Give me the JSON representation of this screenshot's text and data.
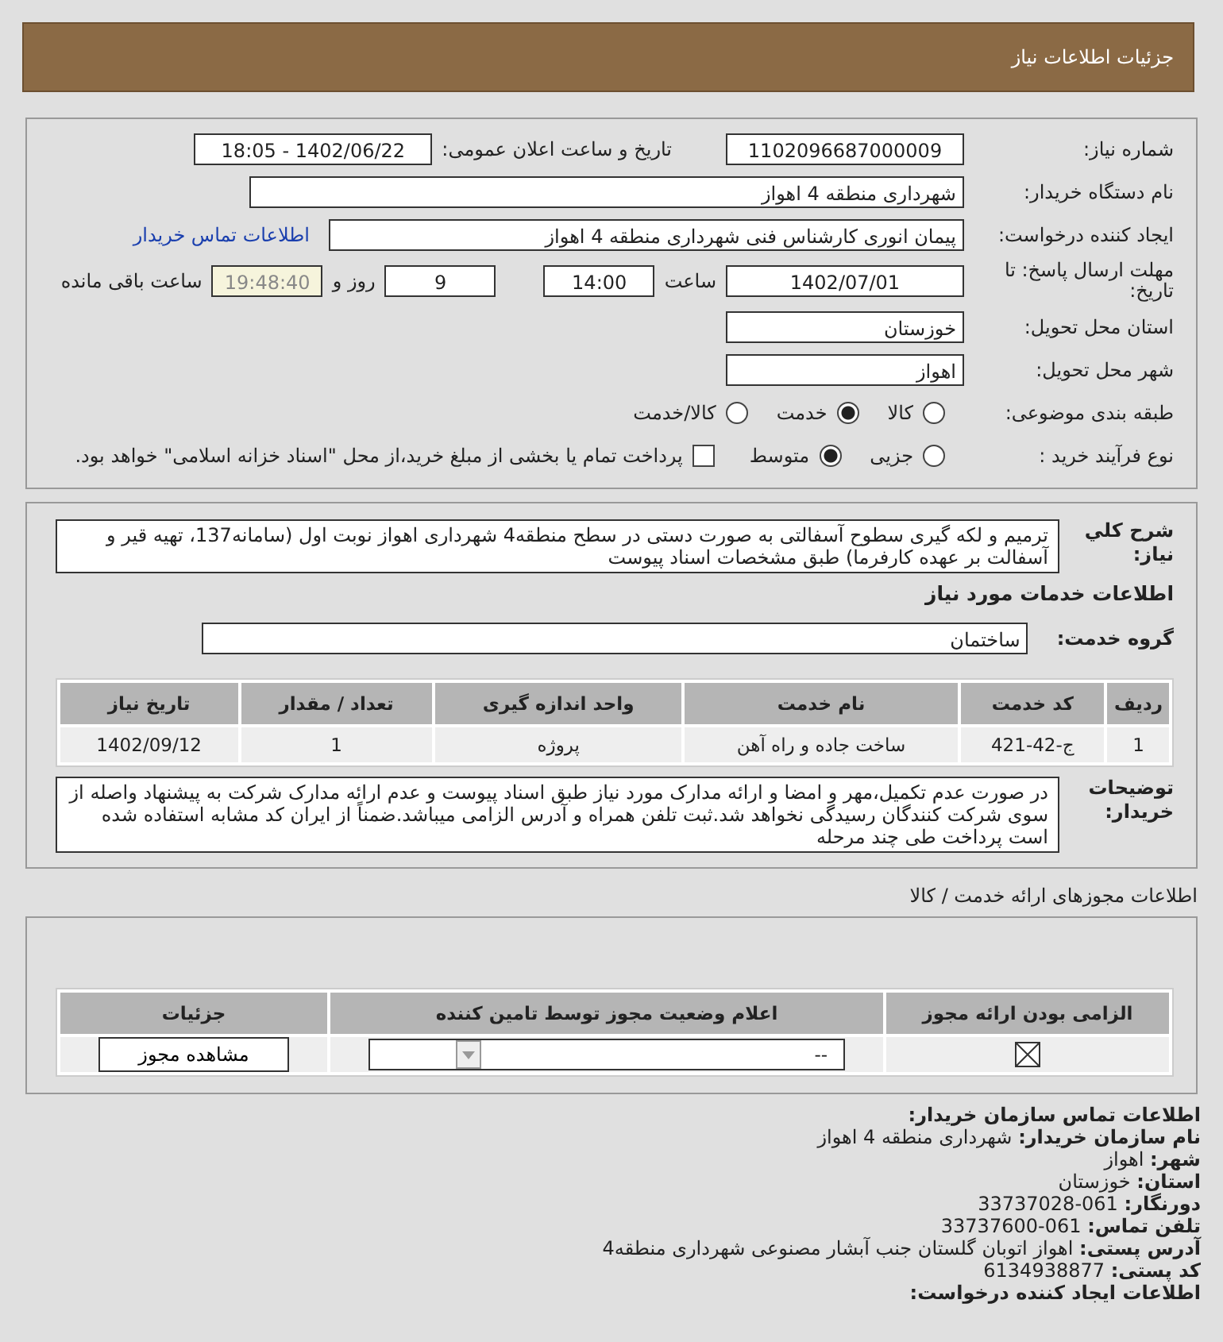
{
  "header": {
    "title": "جزئیات اطلاعات نیاز"
  },
  "need_info": {
    "need_number": {
      "label": "شماره نیاز:",
      "value": "1102096687000009"
    },
    "announce": {
      "label": "تاریخ و ساعت اعلان عمومی:",
      "value": "1402/06/22 - 18:05"
    },
    "buyer_org": {
      "label": "نام دستگاه خریدار:",
      "value": "شهرداری منطقه 4 اهواز"
    },
    "creator": {
      "label": "ایجاد کننده درخواست:",
      "value": "پیمان انوری کارشناس فنی  شهرداری منطقه 4 اهواز",
      "link": "اطلاعات تماس خریدار"
    },
    "deadline": {
      "label": "مهلت ارسال پاسخ: تا تاریخ:",
      "date": "1402/07/01",
      "time_label": "ساعت",
      "time": "14:00",
      "days": "9",
      "days_label": "روز و",
      "remaining": "19:48:40",
      "remaining_label": "ساعت باقی مانده"
    },
    "province": {
      "label": "استان محل تحویل:",
      "value": "خوزستان"
    },
    "city": {
      "label": "شهر محل تحویل:",
      "value": "اهواز"
    },
    "category": {
      "label": "طبقه بندی موضوعی:",
      "options": [
        {
          "label": "کالا",
          "selected": false
        },
        {
          "label": "خدمت",
          "selected": true
        },
        {
          "label": "کالا/خدمت",
          "selected": false
        }
      ]
    },
    "process": {
      "label": "نوع فرآیند خرید :",
      "options": [
        {
          "label": "جزیی",
          "selected": false
        },
        {
          "label": "متوسط",
          "selected": true
        }
      ],
      "treasury": {
        "checked": false,
        "label": "پرداخت تمام یا بخشی از مبلغ خرید،از محل \"اسناد خزانه اسلامی\" خواهد بود."
      }
    }
  },
  "services": {
    "summary": {
      "label": "شرح کلي نیاز:",
      "value": "ترمیم و لکه گیری سطوح آسفالتی به صورت دستی در سطح منطقه4 شهرداری اهواز نوبت اول (سامانه137، تهیه قیر و آسفالت بر عهده کارفرما) طبق مشخصات اسناد پیوست"
    },
    "heading": "اطلاعات خدمات مورد نیاز",
    "group": {
      "label": "گروه خدمت:",
      "value": "ساختمان"
    },
    "table": {
      "columns": [
        "ردیف",
        "کد خدمت",
        "نام خدمت",
        "واحد اندازه گیری",
        "تعداد / مقدار",
        "تاریخ نیاز"
      ],
      "rows": [
        [
          "1",
          "ج-42-421",
          "ساخت جاده و راه آهن",
          "پروژه",
          "1",
          "1402/09/12"
        ]
      ]
    },
    "notes": {
      "label": "توضیحات خریدار:",
      "value": "در صورت عدم تکمیل،مهر و امضا و ارائه مدارک مورد نیاز طبق اسناد پیوست و عدم ارائه مدارک شرکت به پیشنهاد واصله از سوی شرکت کنندگان رسیدگی نخواهد شد.ثبت تلفن همراه و آدرس الزامی میباشد.ضمناً از ایران کد مشابه استفاده شده است پرداخت طی چند مرحله"
    }
  },
  "licenses": {
    "heading": "اطلاعات مجوزهای ارائه خدمت / کالا",
    "columns": [
      "الزامی بودن ارائه مجوز",
      "اعلام وضعیت مجوز توسط تامین کننده",
      "جزئیات"
    ],
    "rows": [
      {
        "status": "--",
        "button": "مشاهده مجوز"
      }
    ]
  },
  "contact": {
    "heading": "اطلاعات تماس سازمان خریدار:",
    "lines": [
      "**نام سازمان خریدار:** شهرداری منطقه 4 اهواز",
      "**شهر:** اهواز",
      "**استان:** خوزستان",
      "**دورنگار:** 061-33737028",
      "**تلفن تماس:** 061-33737600",
      "**آدرس پستی:** اهواز اتوبان گلستان جنب آبشار مصنوعی شهرداری منطقه4",
      "**کد پستی:** 6134938877"
    ],
    "next_heading": "اطلاعات ایجاد کننده درخواست:"
  }
}
